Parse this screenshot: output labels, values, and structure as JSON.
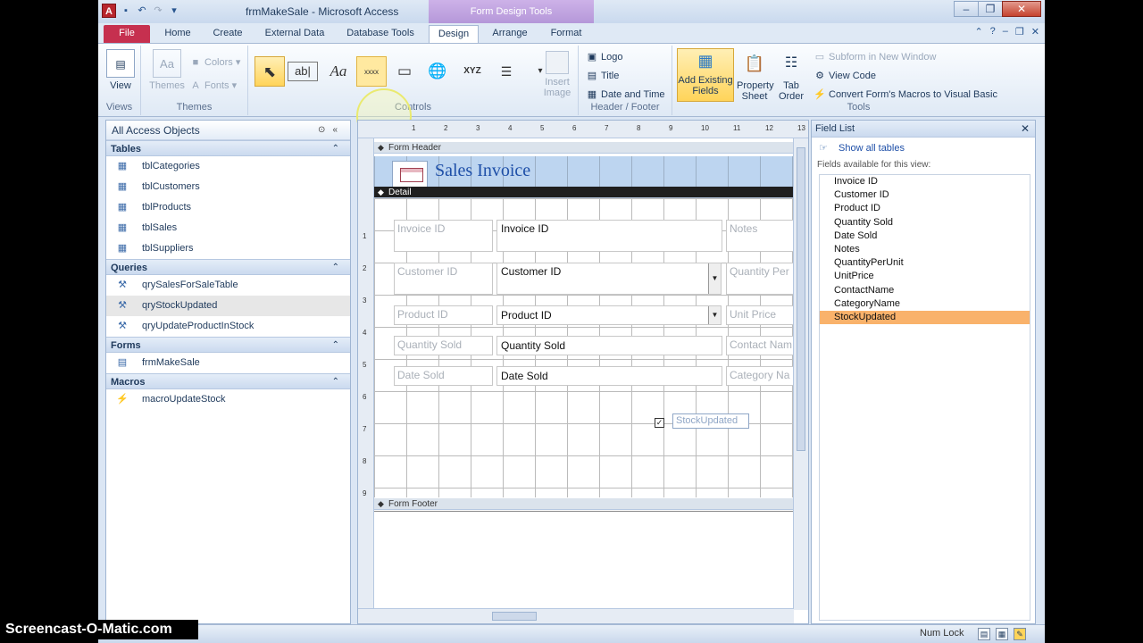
{
  "window": {
    "title": "frmMakeSale - Microsoft Access",
    "context_tab_group": "Form Design Tools"
  },
  "qat": {
    "app_icon": "A"
  },
  "ribbon_tabs": [
    {
      "label": "File"
    },
    {
      "label": "Home"
    },
    {
      "label": "Create"
    },
    {
      "label": "External Data"
    },
    {
      "label": "Database Tools"
    },
    {
      "label": "Design"
    },
    {
      "label": "Arrange"
    },
    {
      "label": "Format"
    }
  ],
  "ribbon": {
    "views": {
      "view_label": "View",
      "group": "Views"
    },
    "themes": {
      "themes_label": "Themes",
      "colors_label": "Colors",
      "fonts_label": "Fonts",
      "group": "Themes"
    },
    "controls": {
      "textbox_glyph": "ab|",
      "label_glyph": "Aa",
      "button_glyph": "xxxx",
      "group": "Controls",
      "insert_image_label": "Insert Image"
    },
    "header_footer": {
      "logo": "Logo",
      "title": "Title",
      "date_time": "Date and Time",
      "group": "Header / Footer"
    },
    "tools": {
      "add_existing_fields": "Add Existing Fields",
      "property_sheet": "Property Sheet",
      "tab_order": "Tab Order",
      "subform_new_window": "Subform in New Window",
      "view_code": "View Code",
      "convert_macros": "Convert Form's Macros to Visual Basic",
      "group": "Tools"
    }
  },
  "nav": {
    "title": "All Access Objects",
    "sections": [
      {
        "title": "Tables",
        "items": [
          "tblCategories",
          "tblCustomers",
          "tblProducts",
          "tblSales",
          "tblSuppliers"
        ]
      },
      {
        "title": "Queries",
        "items": [
          "qrySalesForSaleTable",
          "qryStockUpdated",
          "qryUpdateProductInStock"
        ]
      },
      {
        "title": "Forms",
        "items": [
          "frmMakeSale"
        ]
      },
      {
        "title": "Macros",
        "items": [
          "macroUpdateStock"
        ]
      }
    ]
  },
  "designer": {
    "form_header_label": "Form Header",
    "detail_label": "Detail",
    "form_footer_label": "Form Footer",
    "title": "Sales Invoice",
    "ruler_ticks": [
      "1",
      "2",
      "3",
      "4",
      "5",
      "6",
      "7",
      "8",
      "9",
      "10",
      "11",
      "12",
      "13"
    ],
    "vruler_ticks": [
      "1",
      "2",
      "3",
      "4",
      "5",
      "6",
      "7",
      "8",
      "9"
    ],
    "rows": [
      {
        "label": "Invoice ID",
        "field": "Invoice ID",
        "right_label": "Notes",
        "combo": false
      },
      {
        "label": "Customer ID",
        "field": "Customer ID",
        "right_label": "Quantity Per",
        "combo": true
      },
      {
        "label": "Product ID",
        "field": "Product ID",
        "right_label": "Unit Price",
        "combo": true
      },
      {
        "label": "Quantity Sold",
        "field": "Quantity Sold",
        "right_label": "Contact Nam",
        "combo": false
      },
      {
        "label": "Date Sold",
        "field": "Date Sold",
        "right_label": "Category Na",
        "combo": false
      }
    ],
    "checkbox_label": "StockUpdated"
  },
  "field_list": {
    "title": "Field List",
    "show_all": "Show all tables",
    "available_label": "Fields available for this view:",
    "fields": [
      "Invoice ID",
      "Customer ID",
      "Product ID",
      "Quantity Sold",
      "Date Sold",
      "Notes",
      "QuantityPerUnit",
      "UnitPrice",
      "ContactName",
      "CategoryName",
      "StockUpdated"
    ],
    "selected": "StockUpdated"
  },
  "status": {
    "num_lock": "Num Lock"
  },
  "watermark": "Screencast-O-Matic.com"
}
